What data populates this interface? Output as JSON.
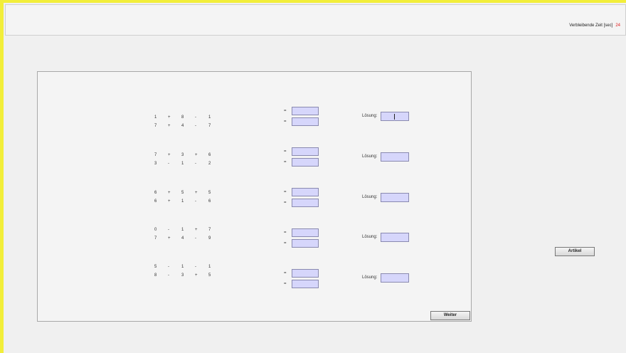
{
  "timer": {
    "label": "Verbleibende Zeit [sec]",
    "value": "24"
  },
  "rows": [
    {
      "line1": [
        "1",
        "+",
        "8",
        "-",
        "1"
      ],
      "line2": [
        "7",
        "+",
        "4",
        "-",
        "7"
      ],
      "solution_label": "Lösung:",
      "eq": "="
    },
    {
      "line1": [
        "7",
        "+",
        "3",
        "+",
        "6"
      ],
      "line2": [
        "3",
        "-",
        "1",
        "-",
        "2"
      ],
      "solution_label": "Lösung:",
      "eq": "="
    },
    {
      "line1": [
        "6",
        "+",
        "5",
        "+",
        "5"
      ],
      "line2": [
        "6",
        "+",
        "1",
        "-",
        "6"
      ],
      "solution_label": "Lösung:",
      "eq": "="
    },
    {
      "line1": [
        "0",
        "-",
        "1",
        "+",
        "7"
      ],
      "line2": [
        "7",
        "+",
        "4",
        "-",
        "9"
      ],
      "solution_label": "Lösung:",
      "eq": "="
    },
    {
      "line1": [
        "5",
        "-",
        "1",
        "-",
        "1"
      ],
      "line2": [
        "8",
        "-",
        "3",
        "+",
        "5"
      ],
      "solution_label": "Lösung:",
      "eq": "="
    }
  ],
  "buttons": {
    "weiter": "Weiter",
    "artikel": "Artikel"
  }
}
